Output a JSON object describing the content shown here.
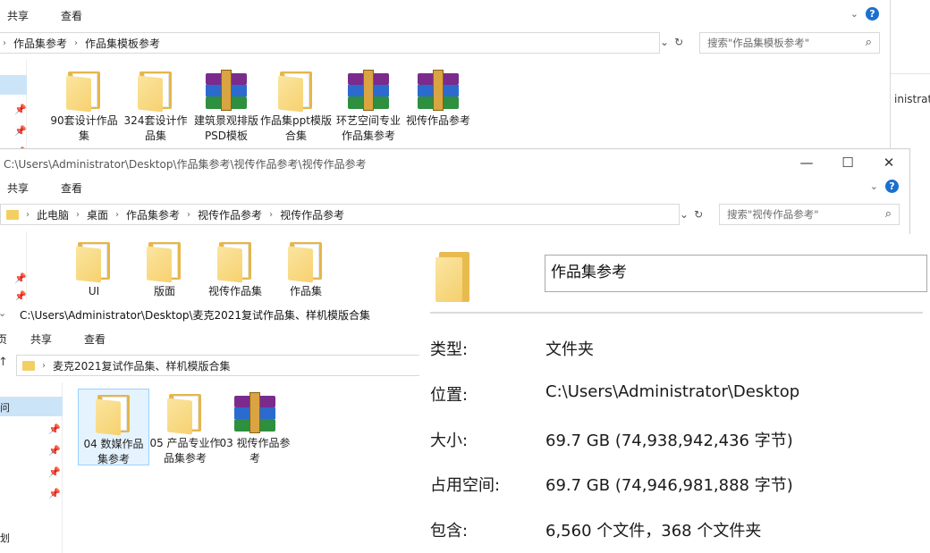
{
  "window1": {
    "ribbon_tabs": [
      "共享",
      "查看"
    ],
    "address": [
      "作品集参考",
      "作品集模板参考"
    ],
    "search_placeholder": "搜索\"作品集模板参考\"",
    "items": [
      {
        "label": "90套设计作品集",
        "icon": "folder-icon"
      },
      {
        "label": "324套设计作品集",
        "icon": "folder-icon"
      },
      {
        "label": "建筑景观排版PSD模板",
        "icon": "archive-icon"
      },
      {
        "label": "作品集ppt模版合集",
        "icon": "folder-icon"
      },
      {
        "label": "环艺空间专业作品集参考",
        "icon": "archive-icon"
      },
      {
        "label": "视传作品参考",
        "icon": "archive-icon"
      }
    ],
    "right_edge_text": "inistrat"
  },
  "window2": {
    "title_path": "C:\\Users\\Administrator\\Desktop\\作品集参考\\视传作品参考\\视传作品参考",
    "ribbon_tabs": [
      "共享",
      "查看"
    ],
    "address": [
      "此电脑",
      "桌面",
      "作品集参考",
      "视传作品参考",
      "视传作品参考"
    ],
    "search_placeholder": "搜索\"视传作品参考\"",
    "items": [
      {
        "label": "UI",
        "icon": "folder-icon"
      },
      {
        "label": "版面",
        "icon": "folder-icon"
      },
      {
        "label": "视传作品集",
        "icon": "folder-icon"
      },
      {
        "label": "作品集",
        "icon": "folder-icon"
      }
    ]
  },
  "window3": {
    "title_path": "C:\\Users\\Administrator\\Desktop\\麦克2021复试作品集、样机模版合集",
    "ribbon_tabs": [
      "页",
      "共享",
      "查看"
    ],
    "address": [
      "麦克2021复试作品集、样机模版合集"
    ],
    "items": [
      {
        "label": "04 数媒作品集参考",
        "icon": "folder-icon",
        "selected": true
      },
      {
        "label": "05 产品专业作品集参考",
        "icon": "folder-icon",
        "selected": false
      },
      {
        "label": "03 视传作品参考",
        "icon": "archive-icon",
        "selected": false
      }
    ],
    "nav_items": [
      "问",
      "划"
    ]
  },
  "properties": {
    "name": "作品集参考",
    "rows": [
      {
        "key": "类型:",
        "value": "文件夹"
      },
      {
        "key": "位置:",
        "value": "C:\\Users\\Administrator\\Desktop"
      },
      {
        "key": "大小:",
        "value": "69.7 GB (74,938,942,436 字节)"
      },
      {
        "key": "占用空间:",
        "value": "69.7 GB (74,946,981,888 字节)"
      },
      {
        "key": "包含:",
        "value": "6,560 个文件，368 个文件夹"
      }
    ]
  }
}
